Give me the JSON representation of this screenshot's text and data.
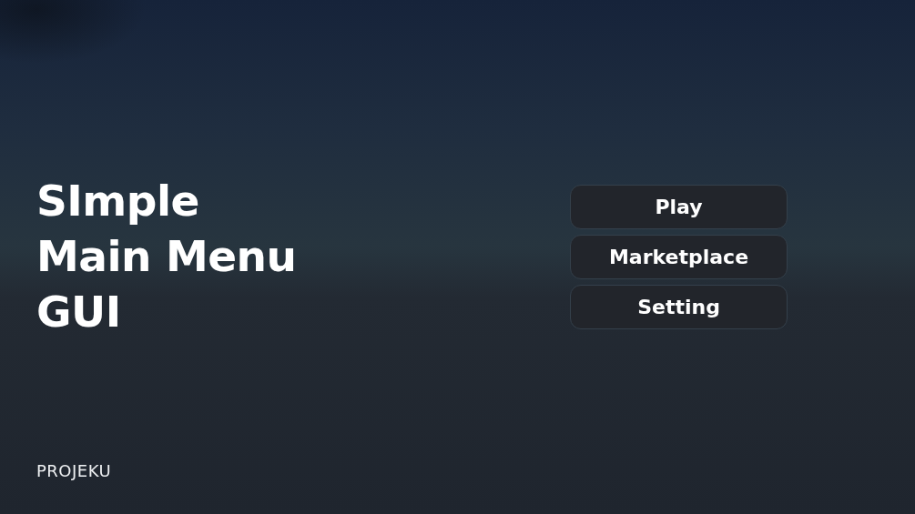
{
  "title": {
    "lines": [
      "SImple",
      "Main Menu",
      "GUI"
    ]
  },
  "menu": {
    "buttons": [
      {
        "label": "Play"
      },
      {
        "label": "Marketplace"
      },
      {
        "label": "Setting"
      }
    ]
  },
  "brand": {
    "logo": "PROJEKU"
  }
}
